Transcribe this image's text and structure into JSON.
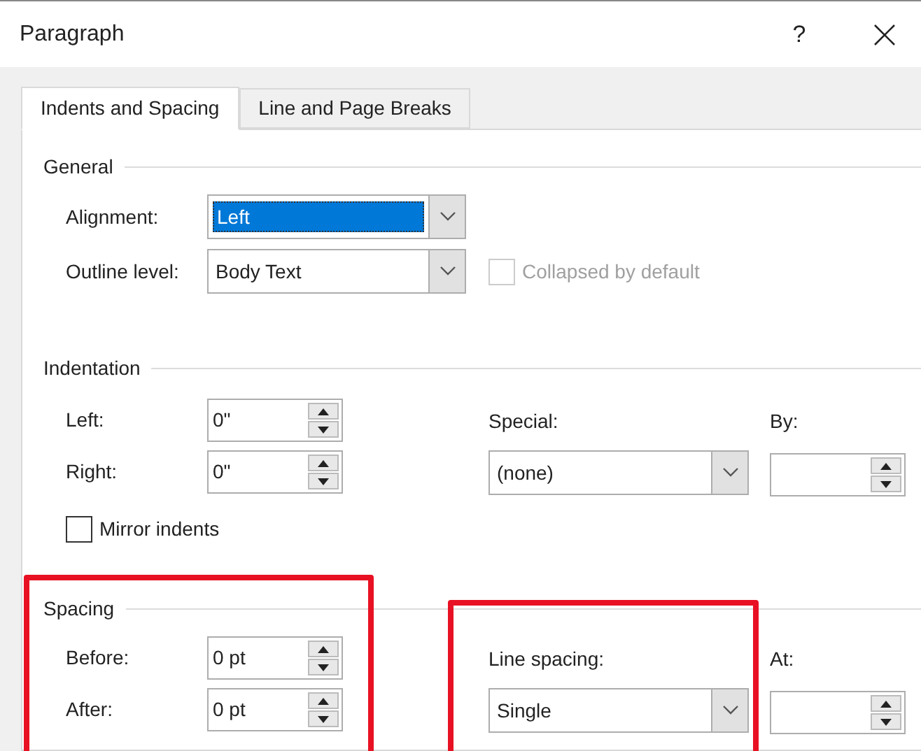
{
  "window": {
    "title": "Paragraph",
    "help": "?"
  },
  "tabs": [
    {
      "label": "Indents and Spacing",
      "selected": true
    },
    {
      "label": "Line and Page Breaks",
      "selected": false
    }
  ],
  "general": {
    "title": "General",
    "alignment": {
      "label": "Alignment:",
      "value": "Left",
      "focused": true
    },
    "outline_level": {
      "label": "Outline level:",
      "value": "Body Text",
      "focused": false
    },
    "collapsed": {
      "label": "Collapsed by default",
      "checked": false,
      "disabled": true
    }
  },
  "indentation": {
    "title": "Indentation",
    "left": {
      "label": "Left:",
      "value": "0\""
    },
    "right": {
      "label": "Right:",
      "value": "0\""
    },
    "special": {
      "label": "Special:",
      "value": "(none)"
    },
    "by": {
      "label": "By:"
    },
    "mirror": {
      "label": "Mirror indents",
      "checked": false,
      "disabled": false
    }
  },
  "spacing": {
    "title": "Spacing",
    "before": {
      "label": "Before:",
      "value": "0 pt"
    },
    "after": {
      "label": "After:",
      "value": "0 pt"
    },
    "line_spacing": {
      "label": "Line spacing:",
      "value": "Single"
    },
    "at": {
      "label": "At:"
    }
  }
}
